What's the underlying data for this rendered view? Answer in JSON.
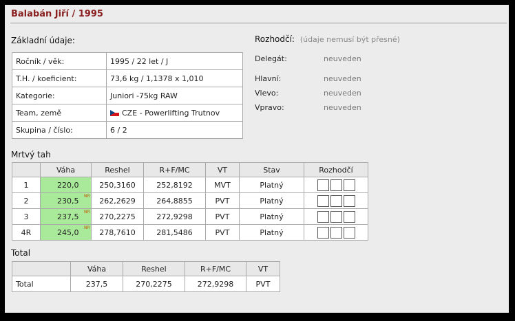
{
  "title": "Balabán Jiří / 1995",
  "basic": {
    "heading": "Základní údaje:",
    "rows": [
      {
        "label": "Ročník / věk:",
        "value": "1995 / 22 let / J"
      },
      {
        "label": "T.H. / koeficient:",
        "value": "73,6 kg / 1,1378 x 1,010"
      },
      {
        "label": "Kategorie:",
        "value": "Juniori -75kg RAW"
      },
      {
        "label": "Team, země",
        "value": "CZE - Powerlifting Trutnov"
      },
      {
        "label": "Skupina / číslo:",
        "value": "6 / 2"
      }
    ],
    "flag_icon": "czech-flag-icon"
  },
  "referees": {
    "heading": "Rozhodčí:",
    "note": "(údaje nemusí být přesné)",
    "rows": [
      {
        "label": "Delegát:",
        "value": "neuveden"
      },
      {
        "label": "Hlavní:",
        "value": "neuveden"
      },
      {
        "label": "Vlevo:",
        "value": "neuveden"
      },
      {
        "label": "Vpravo:",
        "value": "neuveden"
      }
    ]
  },
  "deadlift": {
    "heading": "Mrtvý tah",
    "columns": [
      "",
      "Váha",
      "Reshel",
      "R+F/MC",
      "VT",
      "Stav",
      "Rozhodčí"
    ],
    "rows": [
      {
        "no": "1",
        "weight": "220,0",
        "nr": "",
        "reshel": "250,3160",
        "rfmc": "252,8192",
        "vt": "MVT",
        "stav": "Platný"
      },
      {
        "no": "2",
        "weight": "230,5",
        "nr": "NR",
        "reshel": "262,2629",
        "rfmc": "264,8855",
        "vt": "PVT",
        "stav": "Platný"
      },
      {
        "no": "3",
        "weight": "237,5",
        "nr": "NR",
        "reshel": "270,2275",
        "rfmc": "272,9298",
        "vt": "PVT",
        "stav": "Platný"
      },
      {
        "no": "4R",
        "weight": "245,0",
        "nr": "NR",
        "reshel": "278,7610",
        "rfmc": "281,5486",
        "vt": "PVT",
        "stav": "Platný"
      }
    ]
  },
  "total": {
    "heading": "Total",
    "columns": [
      "",
      "Váha",
      "Reshel",
      "R+F/MC",
      "VT"
    ],
    "row": {
      "label": "Total",
      "weight": "237,5",
      "reshel": "270,2275",
      "rfmc": "272,9298",
      "vt": "PVT"
    }
  },
  "colors": {
    "title": "#8a2020",
    "good_lift": "#a9e99a",
    "record": "#c05a00"
  }
}
